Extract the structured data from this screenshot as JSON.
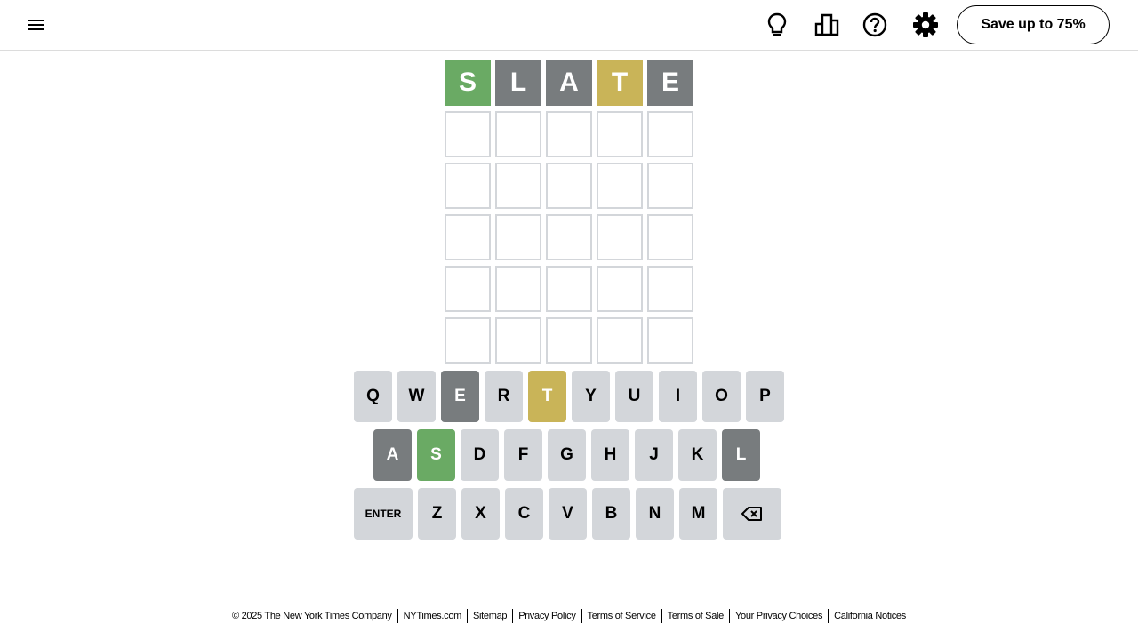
{
  "header": {
    "icons": [
      "menu-icon",
      "lightbulb-icon",
      "bar-chart-icon",
      "help-icon",
      "gear-icon"
    ],
    "save_label": "Save up to 75%"
  },
  "board": {
    "rows": [
      [
        {
          "letter": "S",
          "state": "correct"
        },
        {
          "letter": "L",
          "state": "absent"
        },
        {
          "letter": "A",
          "state": "absent"
        },
        {
          "letter": "T",
          "state": "present"
        },
        {
          "letter": "E",
          "state": "absent"
        }
      ],
      [
        {
          "letter": "",
          "state": "empty"
        },
        {
          "letter": "",
          "state": "empty"
        },
        {
          "letter": "",
          "state": "empty"
        },
        {
          "letter": "",
          "state": "empty"
        },
        {
          "letter": "",
          "state": "empty"
        }
      ],
      [
        {
          "letter": "",
          "state": "empty"
        },
        {
          "letter": "",
          "state": "empty"
        },
        {
          "letter": "",
          "state": "empty"
        },
        {
          "letter": "",
          "state": "empty"
        },
        {
          "letter": "",
          "state": "empty"
        }
      ],
      [
        {
          "letter": "",
          "state": "empty"
        },
        {
          "letter": "",
          "state": "empty"
        },
        {
          "letter": "",
          "state": "empty"
        },
        {
          "letter": "",
          "state": "empty"
        },
        {
          "letter": "",
          "state": "empty"
        }
      ],
      [
        {
          "letter": "",
          "state": "empty"
        },
        {
          "letter": "",
          "state": "empty"
        },
        {
          "letter": "",
          "state": "empty"
        },
        {
          "letter": "",
          "state": "empty"
        },
        {
          "letter": "",
          "state": "empty"
        }
      ],
      [
        {
          "letter": "",
          "state": "empty"
        },
        {
          "letter": "",
          "state": "empty"
        },
        {
          "letter": "",
          "state": "empty"
        },
        {
          "letter": "",
          "state": "empty"
        },
        {
          "letter": "",
          "state": "empty"
        }
      ]
    ]
  },
  "keyboard": {
    "rows": [
      [
        {
          "label": "Q",
          "state": ""
        },
        {
          "label": "W",
          "state": ""
        },
        {
          "label": "E",
          "state": "absent"
        },
        {
          "label": "R",
          "state": ""
        },
        {
          "label": "T",
          "state": "present"
        },
        {
          "label": "Y",
          "state": ""
        },
        {
          "label": "U",
          "state": ""
        },
        {
          "label": "I",
          "state": ""
        },
        {
          "label": "O",
          "state": ""
        },
        {
          "label": "P",
          "state": ""
        }
      ],
      [
        {
          "label": "A",
          "state": "absent"
        },
        {
          "label": "S",
          "state": "correct"
        },
        {
          "label": "D",
          "state": ""
        },
        {
          "label": "F",
          "state": ""
        },
        {
          "label": "G",
          "state": ""
        },
        {
          "label": "H",
          "state": ""
        },
        {
          "label": "J",
          "state": ""
        },
        {
          "label": "K",
          "state": ""
        },
        {
          "label": "L",
          "state": "absent"
        }
      ],
      [
        {
          "label": "ENTER",
          "state": "",
          "wide": true
        },
        {
          "label": "Z",
          "state": ""
        },
        {
          "label": "X",
          "state": ""
        },
        {
          "label": "C",
          "state": ""
        },
        {
          "label": "V",
          "state": ""
        },
        {
          "label": "B",
          "state": ""
        },
        {
          "label": "N",
          "state": ""
        },
        {
          "label": "M",
          "state": ""
        },
        {
          "label": "",
          "icon": "backspace-icon",
          "state": "",
          "wide": true
        }
      ]
    ]
  },
  "colors": {
    "correct": "#6aaa64",
    "present": "#c9b458",
    "absent": "#787c7e",
    "key_default": "#d3d6da",
    "tile_border": "#d3d6da"
  },
  "footer": {
    "copyright": "© 2025 The New York Times Company",
    "links": [
      "NYTimes.com",
      "Sitemap",
      "Privacy Policy",
      "Terms of Service",
      "Terms of Sale",
      "Your Privacy Choices",
      "California Notices"
    ]
  }
}
